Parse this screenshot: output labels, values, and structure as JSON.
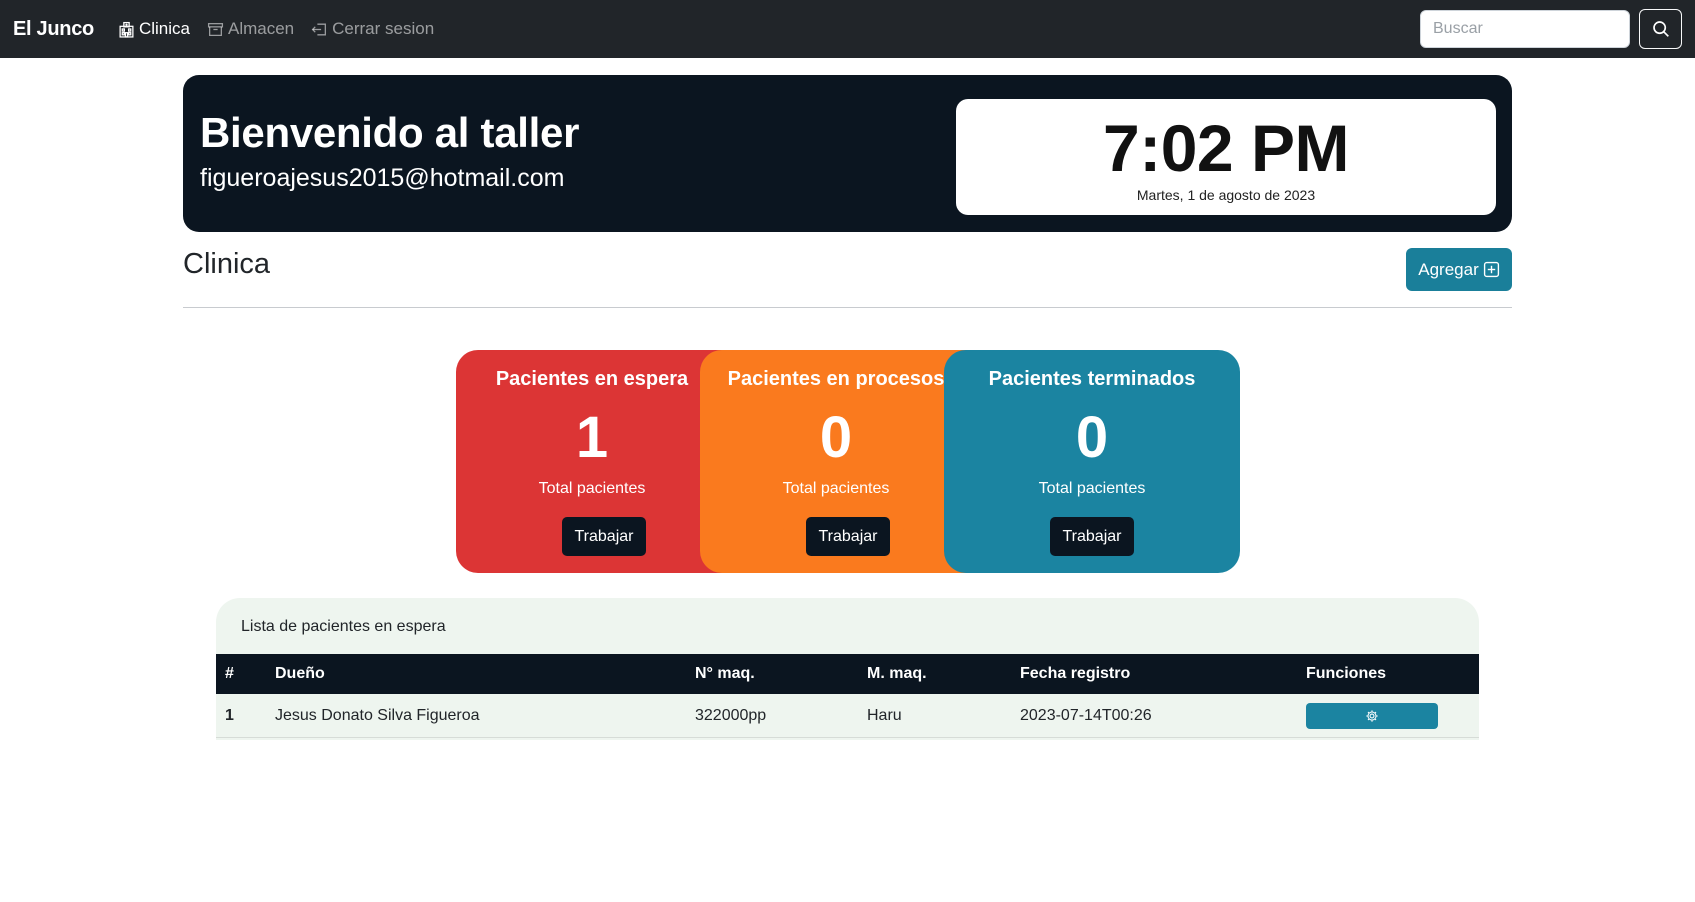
{
  "navbar": {
    "brand": "El Junco",
    "items": [
      {
        "label": "Clinica",
        "icon": "hospital-icon",
        "active": true
      },
      {
        "label": "Almacen",
        "icon": "archive-icon",
        "active": false
      },
      {
        "label": "Cerrar sesion",
        "icon": "logout-icon",
        "active": false
      }
    ],
    "search": {
      "placeholder": "Buscar",
      "value": ""
    },
    "search_button_icon": "search-icon"
  },
  "hero": {
    "title": "Bienvenido al taller",
    "email": "figueroajesus2015@hotmail.com",
    "clock_time": "7:02 PM",
    "clock_date": "Martes, 1 de agosto de 2023"
  },
  "section": {
    "title": "Clinica",
    "add_label": "Agregar",
    "add_icon": "plus-square-icon"
  },
  "cards": [
    {
      "title": "Pacientes en espera",
      "count": "1",
      "subtitle": "Total pacientes",
      "button": "Trabajar",
      "color": "#dc3535"
    },
    {
      "title": "Pacientes en procesos",
      "count": "0",
      "subtitle": "Total pacientes",
      "button": "Trabajar",
      "color": "#fa7a1e"
    },
    {
      "title": "Pacientes terminados",
      "count": "0",
      "subtitle": "Total pacientes",
      "button": "Trabajar",
      "color": "#1b84a1"
    }
  ],
  "table": {
    "title": "Lista de pacientes en espera",
    "headers": [
      "#",
      "Dueño",
      "N° maq.",
      "M. maq.",
      "Fecha registro",
      "Funciones"
    ],
    "rows": [
      {
        "num": "1",
        "owner": "Jesus Donato Silva Figueroa",
        "machine_no": "322000pp",
        "machine_model": "Haru",
        "date": "2023-07-14T00:26",
        "action_icon": "gear-icon"
      }
    ]
  },
  "colors": {
    "navbar": "#212529",
    "hero": "#0b1520",
    "accent": "#1a7f9a",
    "panel": "#eef5ef"
  }
}
